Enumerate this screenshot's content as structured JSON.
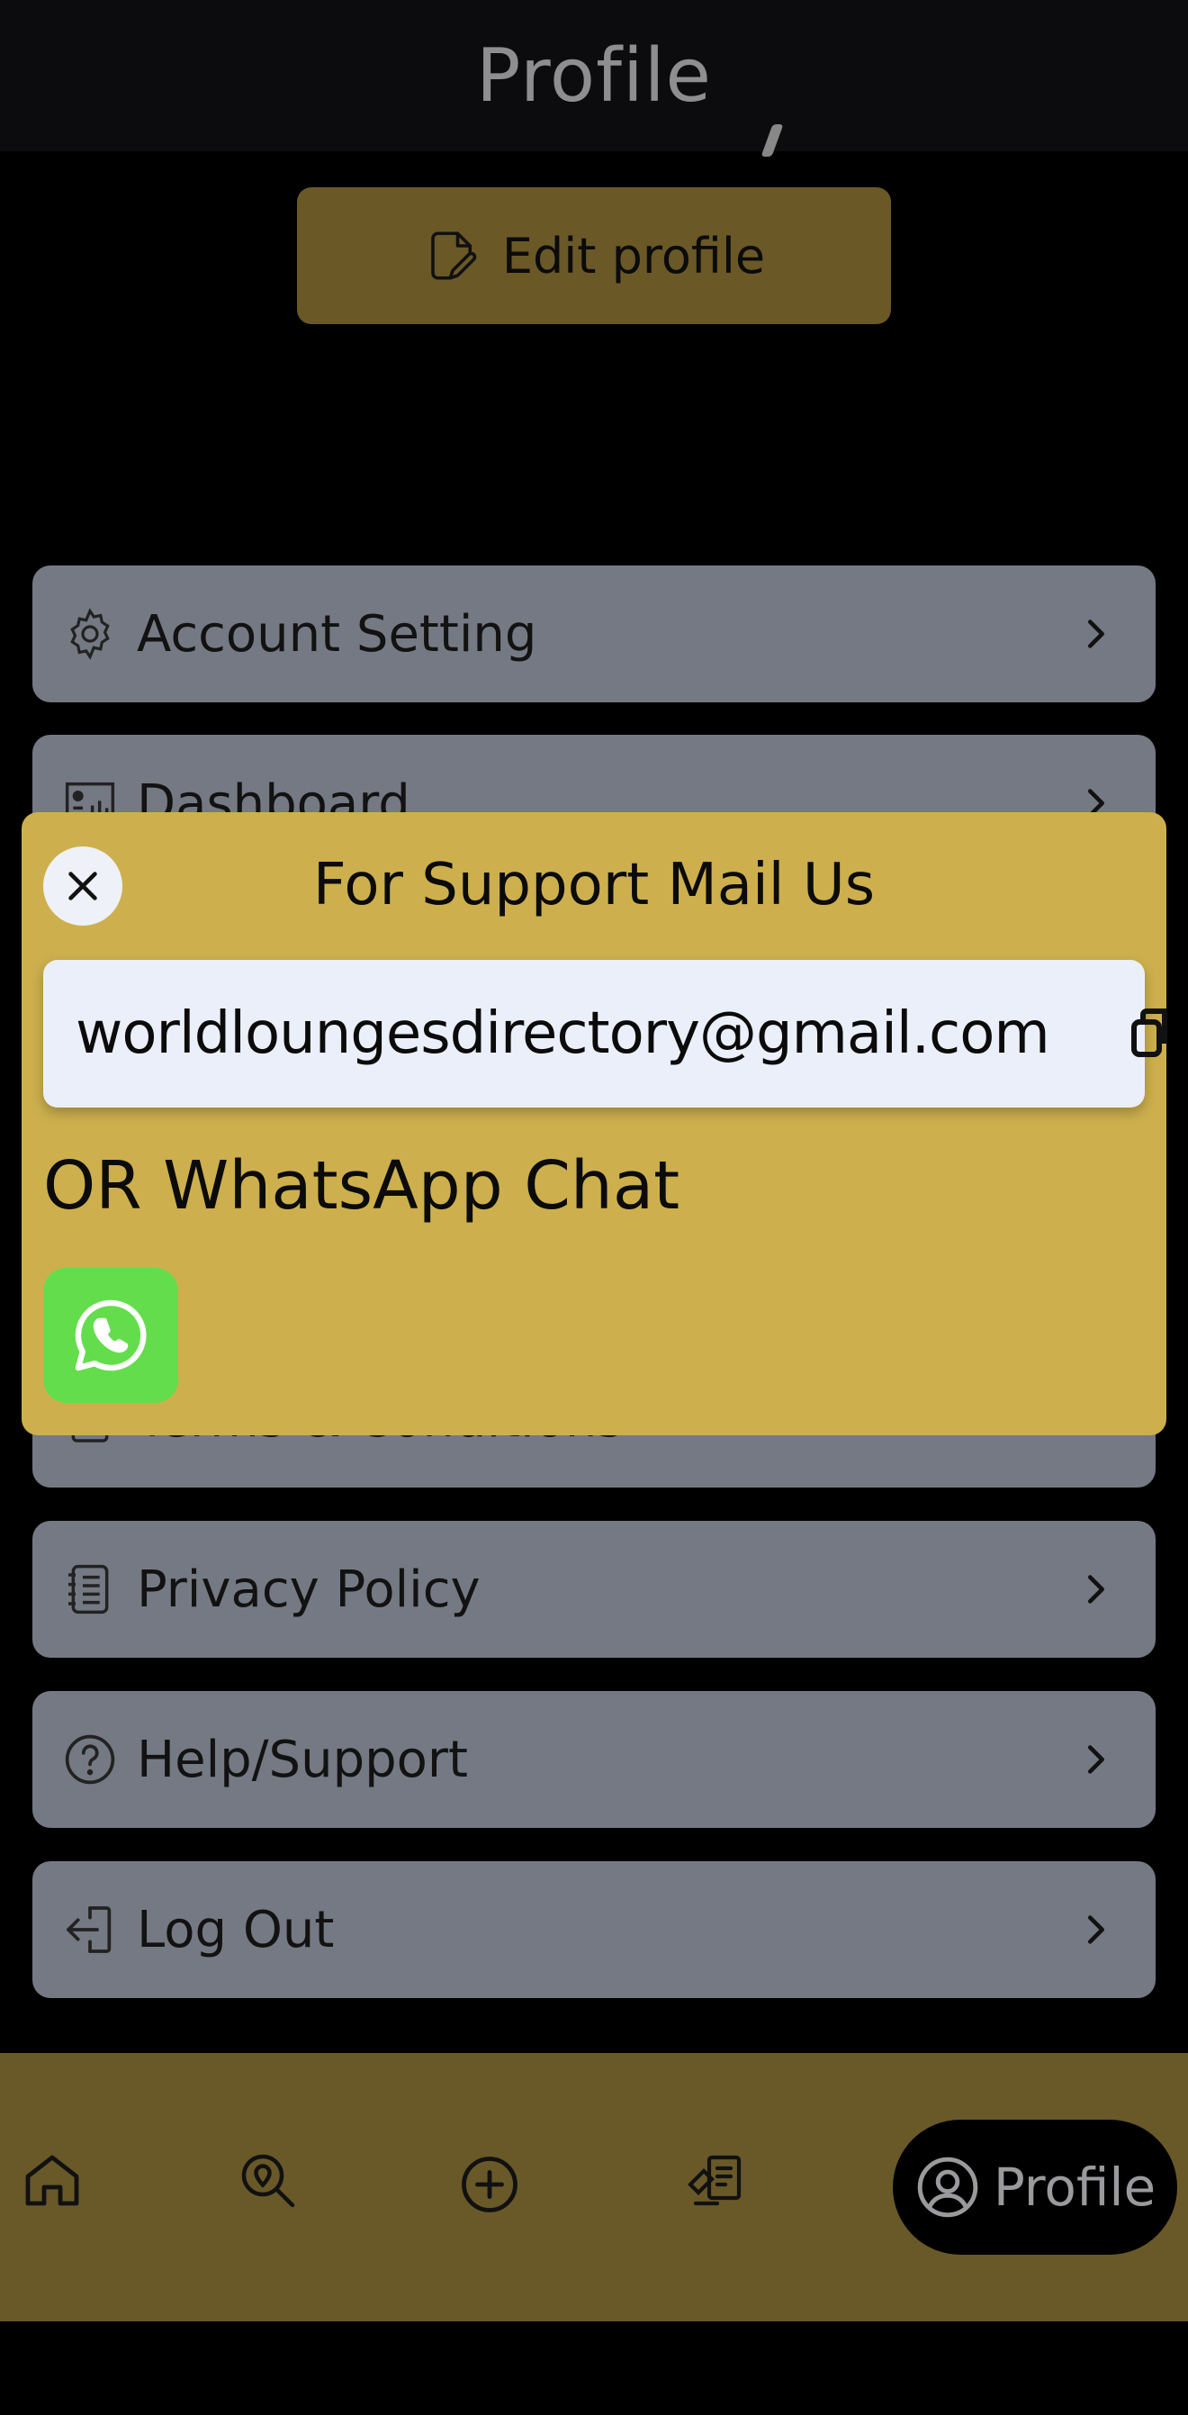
{
  "header": {
    "title": "Profile"
  },
  "profile": {
    "edit_button_label": "Edit profile"
  },
  "menu": {
    "items": [
      {
        "label": "Account Setting",
        "icon": "gear-icon"
      },
      {
        "label": "Dashboard",
        "icon": "dashboard-icon"
      },
      {
        "label": "Terms & Conditions",
        "icon": "document-icon"
      },
      {
        "label": "Privacy Policy",
        "icon": "notebook-icon"
      },
      {
        "label": "Help/Support",
        "icon": "question-circle-icon"
      },
      {
        "label": "Log Out",
        "icon": "logout-icon"
      }
    ]
  },
  "support_sheet": {
    "title": "For Support Mail Us",
    "email": "worldloungesdirectory@gmail.com",
    "alt_contact_label": "OR WhatsApp Chat",
    "whatsapp_icon": "whatsapp-icon"
  },
  "bottom_nav": {
    "items": [
      "home-icon",
      "search-location-icon",
      "add-circle-icon",
      "listings-icon"
    ],
    "active_label": "Profile",
    "active_icon": "user-circle-icon"
  },
  "colors": {
    "accent_gold": "#cdb04d",
    "dim_gold": "#695928",
    "menu_bg": "#757983",
    "whatsapp_green": "#63dd4c"
  }
}
